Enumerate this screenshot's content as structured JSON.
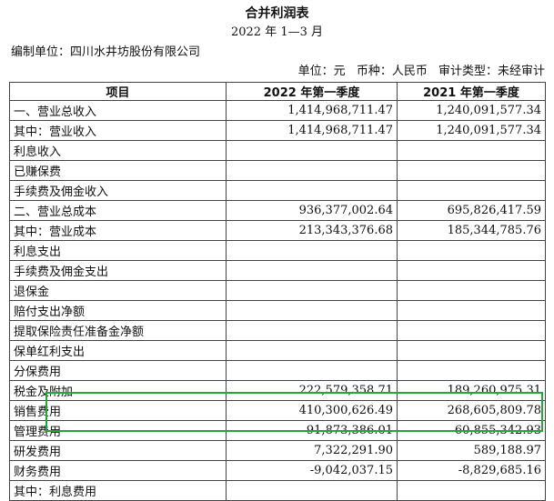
{
  "title": "合并利润表",
  "period": "2022 年 1—3 月",
  "compiler": "编制单位：四川水井坊股份有限公司",
  "meta": {
    "unit": "单位：元",
    "currency": "币种：人民币",
    "audit": "审计类型：未经审计"
  },
  "columns": [
    "项目",
    "2022 年第一季度",
    "2021 年第一季度"
  ],
  "rows": [
    {
      "label": "一、营业总收入",
      "c2022": "1,414,968,711.47",
      "c2021": "1,240,091,577.34"
    },
    {
      "label": "其中：营业收入",
      "c2022": "1,414,968,711.47",
      "c2021": "1,240,091,577.34"
    },
    {
      "label": "利息收入",
      "c2022": "",
      "c2021": ""
    },
    {
      "label": "已赚保费",
      "c2022": "",
      "c2021": ""
    },
    {
      "label": "手续费及佣金收入",
      "c2022": "",
      "c2021": ""
    },
    {
      "label": "二、营业总成本",
      "c2022": "936,377,002.64",
      "c2021": "695,826,417.59"
    },
    {
      "label": "其中：营业成本",
      "c2022": "213,343,376.68",
      "c2021": "185,344,785.76"
    },
    {
      "label": "利息支出",
      "c2022": "",
      "c2021": ""
    },
    {
      "label": "手续费及佣金支出",
      "c2022": "",
      "c2021": ""
    },
    {
      "label": "退保金",
      "c2022": "",
      "c2021": ""
    },
    {
      "label": "赔付支出净额",
      "c2022": "",
      "c2021": ""
    },
    {
      "label": "提取保险责任准备金净额",
      "c2022": "",
      "c2021": ""
    },
    {
      "label": "保单红利支出",
      "c2022": "",
      "c2021": ""
    },
    {
      "label": "分保费用",
      "c2022": "",
      "c2021": ""
    },
    {
      "label": "税金及附加",
      "c2022": "222,579,358.71",
      "c2021": "189,260,975.31"
    },
    {
      "label": "销售费用",
      "c2022": "410,300,626.49",
      "c2021": "268,605,809.78"
    },
    {
      "label": "管理费用",
      "c2022": "91,873,386.01",
      "c2021": "60,855,342.93"
    },
    {
      "label": "研发费用",
      "c2022": "7,322,291.90",
      "c2021": "589,188.97"
    },
    {
      "label": "财务费用",
      "c2022": "-9,042,037.15",
      "c2021": "-8,829,685.16"
    },
    {
      "label": "其中：利息费用",
      "c2022": "",
      "c2021": ""
    }
  ],
  "highlight_color": "#22a83a"
}
